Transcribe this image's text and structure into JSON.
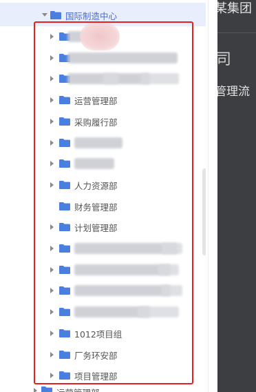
{
  "tree": {
    "parent": {
      "label": "国际制造中心"
    },
    "items": [
      {
        "label": "",
        "has_caret": true,
        "redacted": true
      },
      {
        "label": "",
        "has_caret": true,
        "redacted": true
      },
      {
        "label": "",
        "has_caret": true,
        "redacted": true
      },
      {
        "label": "运营管理部",
        "has_caret": true,
        "redacted": false
      },
      {
        "label": "采购履行部",
        "has_caret": true,
        "redacted": false
      },
      {
        "label": "",
        "has_caret": true,
        "redacted": true
      },
      {
        "label": "",
        "has_caret": true,
        "redacted": true
      },
      {
        "label": "人力资源部",
        "has_caret": true,
        "redacted": false
      },
      {
        "label": "财务管理部",
        "has_caret": false,
        "redacted": false
      },
      {
        "label": "计划管理部",
        "has_caret": true,
        "redacted": false
      },
      {
        "label": "",
        "has_caret": true,
        "redacted": true
      },
      {
        "label": "",
        "has_caret": true,
        "redacted": true
      },
      {
        "label": "",
        "has_caret": true,
        "redacted": true
      },
      {
        "label": "",
        "has_caret": true,
        "redacted": true
      },
      {
        "label": "1012项目组",
        "has_caret": true,
        "redacted": false
      },
      {
        "label": "厂务环安部",
        "has_caret": true,
        "redacted": false
      },
      {
        "label": "项目管理部",
        "has_caret": true,
        "redacted": false
      }
    ],
    "next_sibling": {
      "label": "运营管理部"
    }
  },
  "right_panel": {
    "title": "某集团",
    "glyph": "司",
    "subtitle": "管理流"
  },
  "colors": {
    "folder": "#4a7fe0",
    "highlight_row": "#e8eefb",
    "annotation_box": "#e6201f",
    "dark_panel": "#3d3e42"
  }
}
